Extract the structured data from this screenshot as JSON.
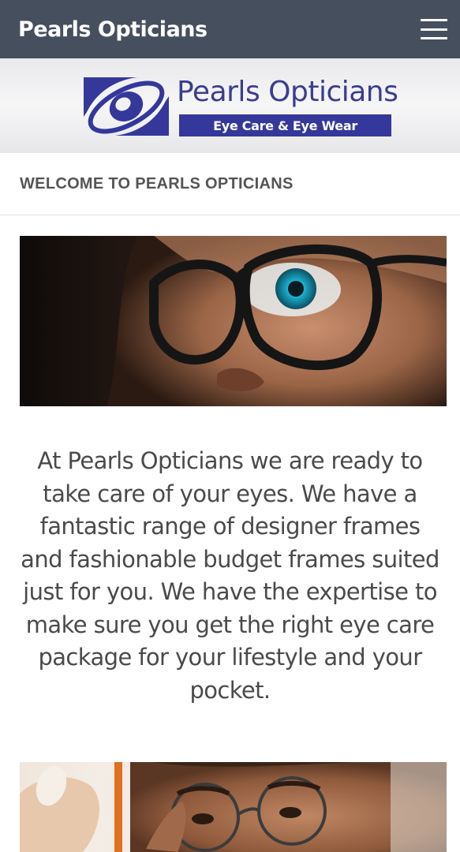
{
  "header": {
    "site_title": "Pearls Opticians",
    "menu_icon": "hamburger-menu-icon"
  },
  "logo": {
    "name": "Pearls Opticians",
    "tagline": "Eye Care & Eye Wear",
    "brand_color": "#34389a"
  },
  "welcome": {
    "heading": "WELCOME TO PEARLS OPTICIANS"
  },
  "intro": {
    "text": "At Pearls Opticians we are ready to take care of your eyes. We have a fantastic range of designer frames and fashionable budget frames suited just for you. We have the expertise to make sure you get the right eye care package for your lifestyle and your pocket."
  },
  "colors": {
    "topbar": "#464f5e",
    "heading_text": "#555555",
    "body_text": "#4a4a4a"
  }
}
